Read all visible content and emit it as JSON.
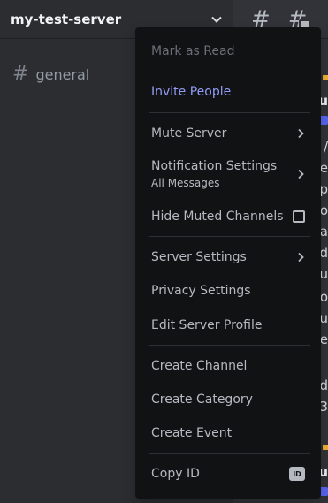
{
  "server": {
    "name": "my-test-server"
  },
  "channels": [
    {
      "name": "general"
    }
  ],
  "chat_fragments": [
    {
      "text": "u",
      "bold": true
    },
    {
      "text": "/"
    },
    {
      "text": "re"
    },
    {
      "text": "p"
    },
    {
      "text": "o"
    },
    {
      "text": "ea"
    },
    {
      "text": "d"
    },
    {
      "text": "ou"
    },
    {
      "text": "ro"
    },
    {
      "text": "tu"
    },
    {
      "text": "e"
    },
    {
      "text": "d"
    },
    {
      "text": "3"
    },
    {
      "text": "u",
      "bold": true
    }
  ],
  "menu": {
    "mark_as_read": "Mark as Read",
    "invite_people": "Invite People",
    "mute_server": "Mute Server",
    "notification_settings": "Notification Settings",
    "notification_sub": "All Messages",
    "hide_muted_channels": "Hide Muted Channels",
    "server_settings": "Server Settings",
    "privacy_settings": "Privacy Settings",
    "edit_server_profile": "Edit Server Profile",
    "create_channel": "Create Channel",
    "create_category": "Create Category",
    "create_event": "Create Event",
    "copy_id": "Copy ID",
    "id_badge": "ID"
  },
  "colors": {
    "accent": "#949cf7",
    "menu_bg": "#111214",
    "sidebar_bg": "#2b2d31",
    "chat_bg": "#313338"
  }
}
